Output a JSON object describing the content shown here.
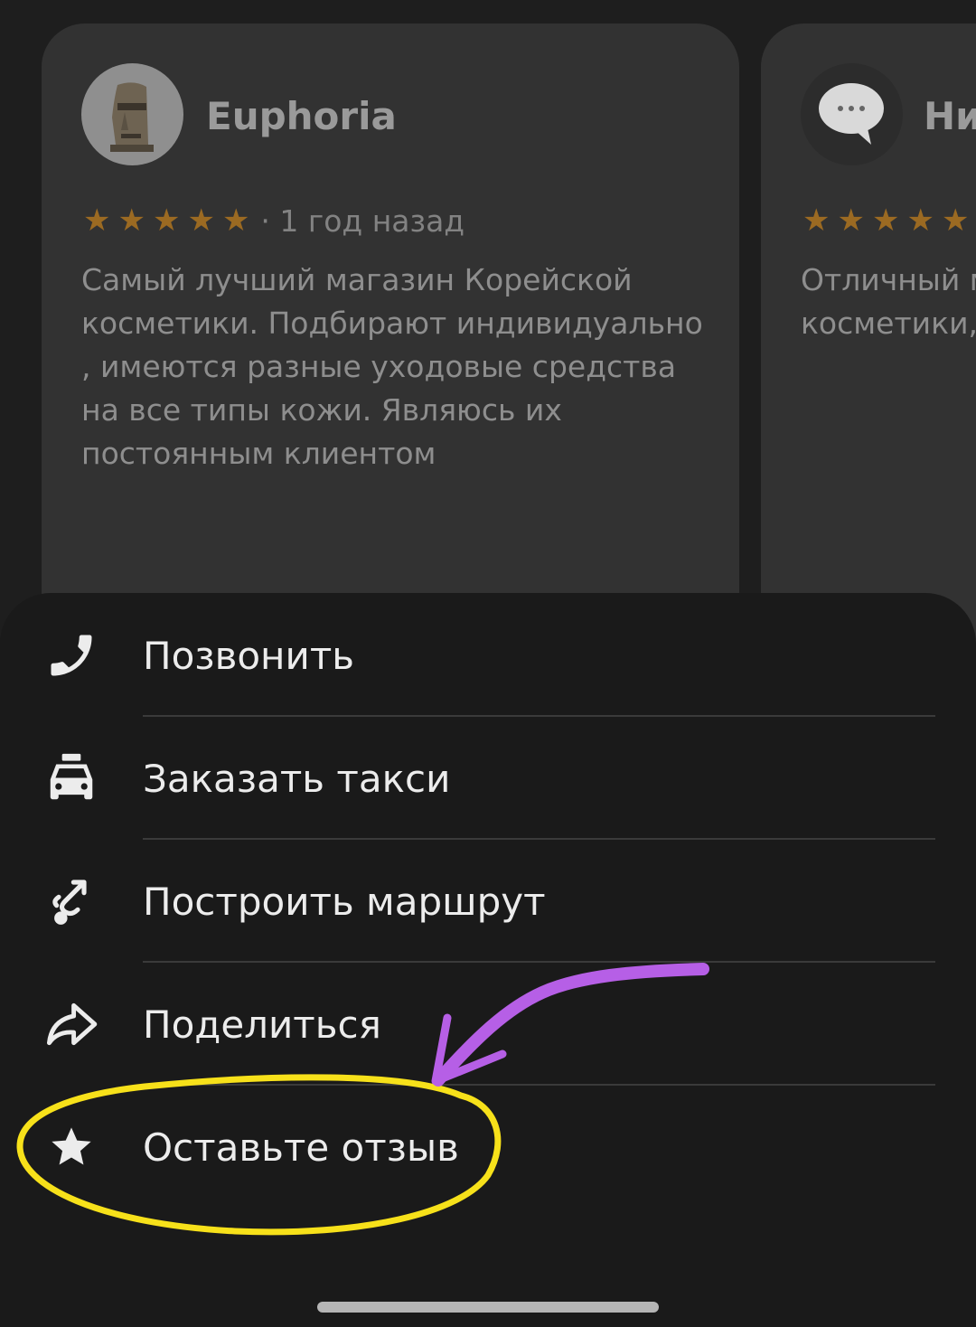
{
  "reviews": [
    {
      "author": "Euphoria",
      "stars": 5,
      "date": "· 1 год назад",
      "text": "Самый лучший магазин Корейской косметики. Подбирают индивидуально , имеются разные уходовые средства на все типы кожи. Являюсь их постоянным клиентом",
      "avatar_icon": "moai-icon"
    },
    {
      "author": "Ни",
      "stars": 5,
      "text_lines": [
        "Отличный м",
        "косметики,"
      ],
      "avatar_icon": "speech-bubble-icon"
    }
  ],
  "menu": {
    "items": [
      {
        "label": "Позвонить",
        "icon": "phone-icon"
      },
      {
        "label": "Заказать такси",
        "icon": "taxi-icon"
      },
      {
        "label": "Построить маршрут",
        "icon": "route-icon"
      },
      {
        "label": "Поделиться",
        "icon": "share-icon"
      },
      {
        "label": "Оставьте отзыв",
        "icon": "star-icon"
      }
    ]
  },
  "colors": {
    "background": "#1e1e1e",
    "card": "#323232",
    "sheet": "#1a1a1a",
    "star": "#9b6a22",
    "annotation_yellow": "#f7e11a",
    "annotation_purple": "#b65fe6"
  }
}
